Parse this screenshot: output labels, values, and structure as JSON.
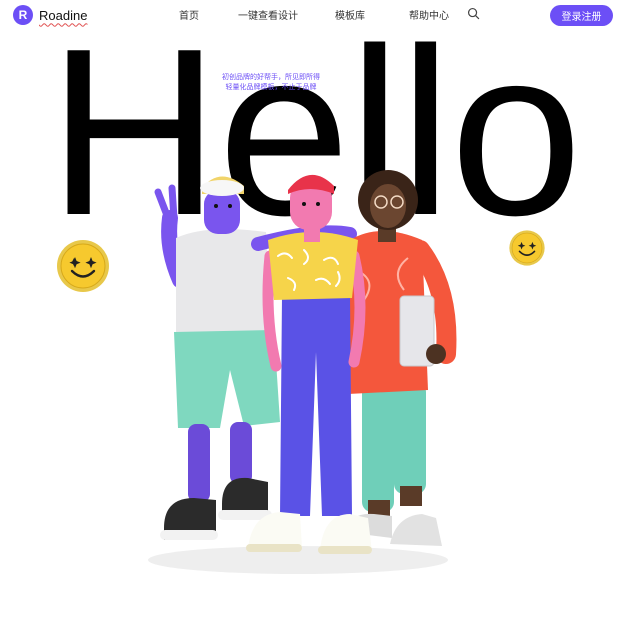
{
  "nav": {
    "brand": "Roadine",
    "brand_initial": "R",
    "links": [
      "首页",
      "一键查看设计",
      "模板库",
      "帮助中心"
    ],
    "search_icon": "search-icon",
    "cta_label": "登录注册"
  },
  "hero": {
    "word": "Hello",
    "tagline_line1": "初创品牌的好帮手，所见即所得",
    "tagline_line2": "轻量化品牌模板，不止于品牌"
  },
  "colors": {
    "accent": "#6c4ff6",
    "smiley": "#f3c530"
  }
}
